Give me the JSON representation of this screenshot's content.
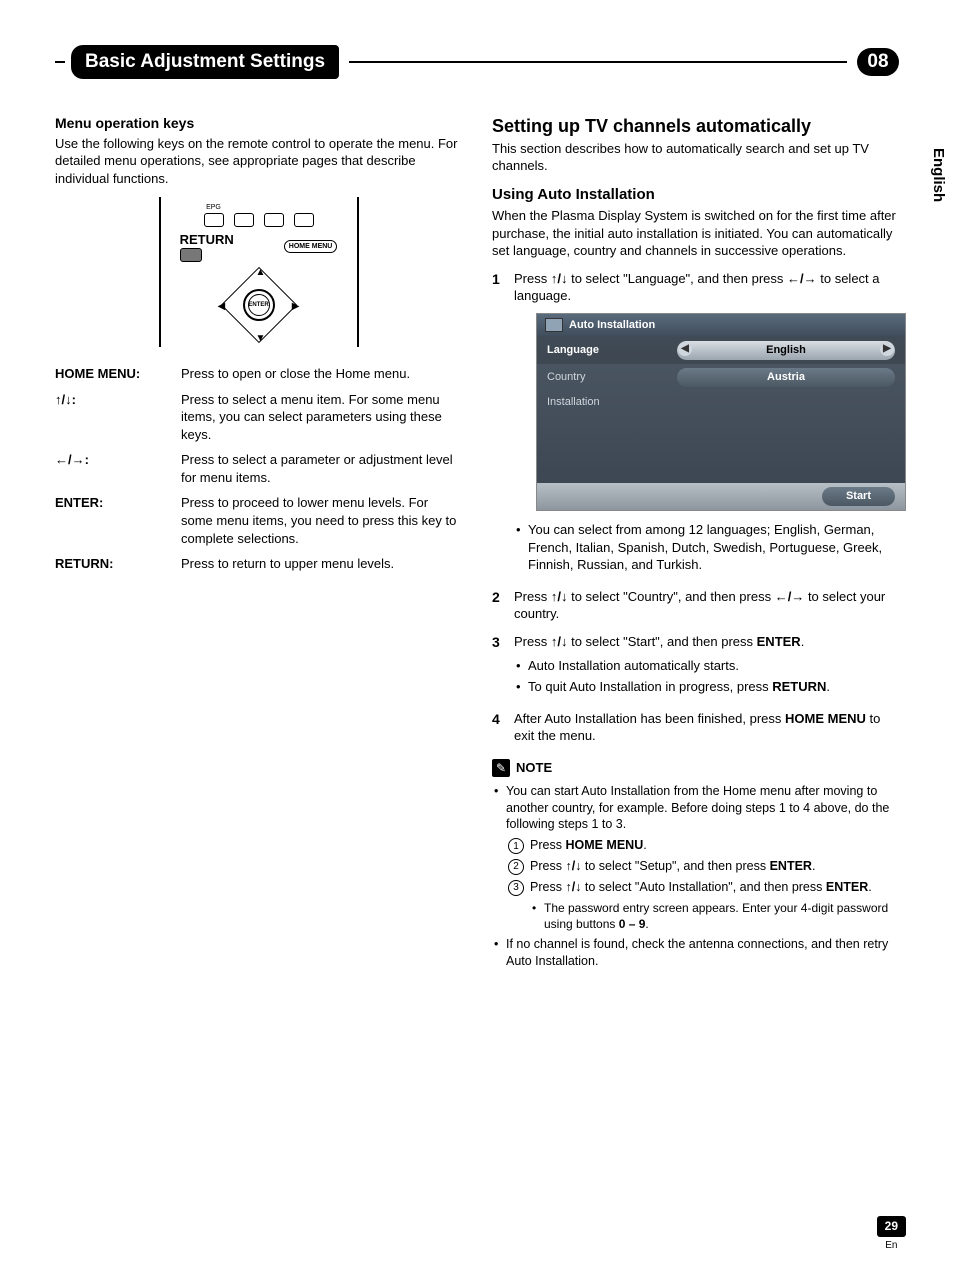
{
  "chapter": {
    "title": "Basic Adjustment Settings",
    "number": "08"
  },
  "language_tab": "English",
  "page": {
    "number": "29",
    "lang_code": "En"
  },
  "left": {
    "h2": "Menu operation keys",
    "intro": "Use the following keys on the remote control to operate the menu. For detailed menu operations, see appropriate pages that describe individual functions.",
    "remote": {
      "epg": "EPG",
      "return": "RETURN",
      "home_menu": "HOME MENU",
      "enter": "ENTER"
    },
    "keys": {
      "home_menu_k": "HOME MENU:",
      "home_menu_v": "Press to open or close the Home menu.",
      "ud_k": "↑/↓:",
      "ud_v": "Press to select a menu item. For some menu items, you can select parameters using these keys.",
      "lr_k": "←/→:",
      "lr_v": "Press to select a parameter or adjustment level for menu items.",
      "enter_k": "ENTER:",
      "enter_v": "Press to proceed to lower menu levels. For some menu items, you need to press this key to complete selections.",
      "return_k": "RETURN:",
      "return_v": "Press to return to upper menu levels."
    }
  },
  "right": {
    "h1": "Setting up TV channels automatically",
    "intro": "This section describes how to automatically search and set up TV channels.",
    "h3": "Using Auto Installation",
    "p1": "When the Plasma Display System is switched on for the first time after purchase, the initial auto installation is initiated. You can automatically set language, country and channels in successive operations.",
    "steps": {
      "s1a": "Press ",
      "s1b": " to select \"Language\", and then press ",
      "s1c": " to select a language.",
      "s1_note": "You can select from among 12 languages; English, German, French, Italian, Spanish, Dutch, Swedish, Portuguese, Greek, Finnish, Russian, and Turkish.",
      "s2a": "Press ",
      "s2b": " to select \"Country\", and then press ",
      "s2c": " to select your country.",
      "s3a": "Press ",
      "s3b": " to select \"Start\", and then press ",
      "s3c": "ENTER",
      "s3d": ".",
      "s3_b1": "Auto Installation automatically starts.",
      "s3_b2a": "To quit Auto Installation in progress, press ",
      "s3_b2b": "RETURN",
      "s3_b2c": ".",
      "s4a": "After Auto Installation has been finished, press ",
      "s4b": "HOME MENU",
      "s4c": " to exit the menu."
    },
    "osd": {
      "title": "Auto Installation",
      "row_lang": "Language",
      "row_lang_val": "English",
      "row_country": "Country",
      "row_country_val": "Austria",
      "row_install": "Installation",
      "start": "Start"
    },
    "note": {
      "label": "NOTE",
      "p1": "You can start Auto Installation from the Home menu after moving to another country, for example. Before doing steps 1 to 4 above, do the following steps 1 to 3.",
      "c1a": "Press ",
      "c1b": "HOME MENU",
      "c1c": ".",
      "c2a": "Press ",
      "c2b": " to select \"Setup\", and then press ",
      "c2c": "ENTER",
      "c2d": ".",
      "c3a": "Press ",
      "c3b": " to select \"Auto Installation\", and then press ",
      "c3c": "ENTER",
      "c3d": ".",
      "c3_sub_a": "The password entry screen appears. Enter your 4-digit password using buttons ",
      "c3_sub_b": "0 – 9",
      "c3_sub_c": ".",
      "p2": "If no channel is found, check the antenna connections, and then retry Auto Installation."
    }
  },
  "arrows": {
    "ud": "↑/↓",
    "lr": "←/→"
  }
}
